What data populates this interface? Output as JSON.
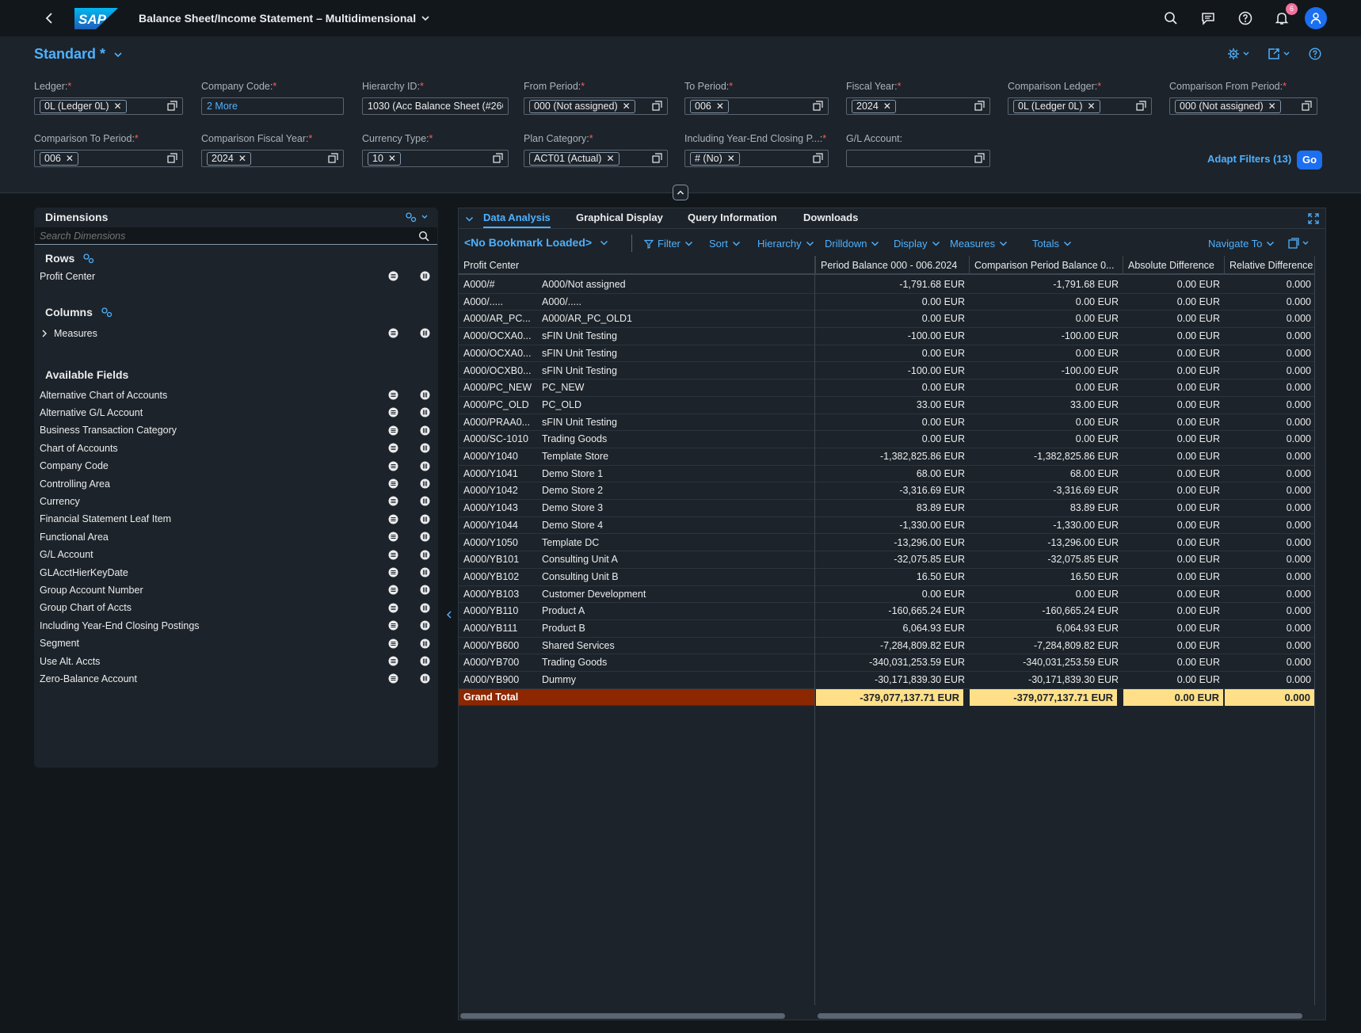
{
  "app": {
    "title": "Balance Sheet/Income Statement – Multidimensional",
    "logo_text": "SAP",
    "notification_count": "6"
  },
  "variant": {
    "name": "Standard *"
  },
  "filters": [
    {
      "label": "Ledger:",
      "type": "token",
      "value": "0L (Ledger 0L)"
    },
    {
      "label": "Company Code:",
      "type": "more",
      "value": "2 More"
    },
    {
      "label": "Hierarchy ID:",
      "type": "text",
      "value": "1030 (Acc Balance Sheet (#266"
    },
    {
      "label": "From Period:",
      "type": "token",
      "value": "000 (Not assigned)"
    },
    {
      "label": "To Period:",
      "type": "token",
      "value": "006"
    },
    {
      "label": "Fiscal Year:",
      "type": "token",
      "value": "2024"
    },
    {
      "label": "Comparison Ledger:",
      "type": "token",
      "value": "0L (Ledger 0L)"
    },
    {
      "label": "Comparison From Period:",
      "type": "token",
      "value": "000 (Not assigned)"
    },
    {
      "label": "Comparison To Period:",
      "type": "token",
      "value": "006"
    },
    {
      "label": "Comparison Fiscal Year:",
      "type": "token",
      "value": "2024"
    },
    {
      "label": "Currency Type:",
      "type": "token",
      "value": "10"
    },
    {
      "label": "Plan Category:",
      "type": "token",
      "value": "ACT01 (Actual)"
    },
    {
      "label": "Including Year-End Closing P...:",
      "type": "token",
      "value": "# (No)"
    },
    {
      "label": "G/L Account:",
      "type": "empty",
      "value": ""
    }
  ],
  "filterbar": {
    "adapt_label": "Adapt Filters (13)",
    "go_label": "Go"
  },
  "dimensions": {
    "title": "Dimensions",
    "search_placeholder": "Search Dimensions",
    "rows_title": "Rows",
    "rows": [
      "Profit Center"
    ],
    "columns_title": "Columns",
    "columns": [
      "Measures"
    ],
    "available_title": "Available Fields",
    "available": [
      "Alternative Chart of Accounts",
      "Alternative G/L Account",
      "Business Transaction Category",
      "Chart of Accounts",
      "Company Code",
      "Controlling Area",
      "Currency",
      "Financial Statement Leaf Item",
      "Functional Area",
      "G/L Account",
      "GLAcctHierKeyDate",
      "Group Account Number",
      "Group Chart of Accts",
      "Including Year-End Closing Postings",
      "Segment",
      "Use Alt. Accts",
      "Zero-Balance Account"
    ]
  },
  "tabs": [
    "Data Analysis",
    "Graphical Display",
    "Query Information",
    "Downloads"
  ],
  "toolbar": {
    "bookmark": "<No Bookmark Loaded>",
    "items": [
      "Filter",
      "Sort",
      "Hierarchy",
      "Drilldown",
      "Display",
      "Measures",
      "Totals"
    ],
    "navigate": "Navigate To"
  },
  "table": {
    "headers": [
      "Profit Center",
      "Period Balance 000 - 006.2024",
      "Comparison Period Balance 0...",
      "Absolute Difference",
      "Relative Difference"
    ],
    "rows": [
      [
        "A000/#",
        "A000/Not assigned",
        "-1,791.68 EUR",
        "-1,791.68 EUR",
        "0.00 EUR",
        "0.000"
      ],
      [
        "A000/.....",
        "A000/.....",
        "0.00 EUR",
        "0.00 EUR",
        "0.00 EUR",
        "0.000"
      ],
      [
        "A000/AR_PC...",
        "A000/AR_PC_OLD1",
        "0.00 EUR",
        "0.00 EUR",
        "0.00 EUR",
        "0.000"
      ],
      [
        "A000/OCXA0...",
        "sFIN Unit Testing",
        "-100.00 EUR",
        "-100.00 EUR",
        "0.00 EUR",
        "0.000"
      ],
      [
        "A000/OCXA0...",
        "sFIN Unit Testing",
        "0.00 EUR",
        "0.00 EUR",
        "0.00 EUR",
        "0.000"
      ],
      [
        "A000/OCXB0...",
        "sFIN Unit Testing",
        "-100.00 EUR",
        "-100.00 EUR",
        "0.00 EUR",
        "0.000"
      ],
      [
        "A000/PC_NEW",
        "PC_NEW",
        "0.00 EUR",
        "0.00 EUR",
        "0.00 EUR",
        "0.000"
      ],
      [
        "A000/PC_OLD",
        "PC_OLD",
        "33.00 EUR",
        "33.00 EUR",
        "0.00 EUR",
        "0.000"
      ],
      [
        "A000/PRAA0...",
        "sFIN Unit Testing",
        "0.00 EUR",
        "0.00 EUR",
        "0.00 EUR",
        "0.000"
      ],
      [
        "A000/SC-1010",
        "Trading Goods",
        "0.00 EUR",
        "0.00 EUR",
        "0.00 EUR",
        "0.000"
      ],
      [
        "A000/Y1040",
        "Template Store",
        "-1,382,825.86 EUR",
        "-1,382,825.86 EUR",
        "0.00 EUR",
        "0.000"
      ],
      [
        "A000/Y1041",
        "Demo Store 1",
        "68.00 EUR",
        "68.00 EUR",
        "0.00 EUR",
        "0.000"
      ],
      [
        "A000/Y1042",
        "Demo Store 2",
        "-3,316.69 EUR",
        "-3,316.69 EUR",
        "0.00 EUR",
        "0.000"
      ],
      [
        "A000/Y1043",
        "Demo Store 3",
        "83.89 EUR",
        "83.89 EUR",
        "0.00 EUR",
        "0.000"
      ],
      [
        "A000/Y1044",
        "Demo Store 4",
        "-1,330.00 EUR",
        "-1,330.00 EUR",
        "0.00 EUR",
        "0.000"
      ],
      [
        "A000/Y1050",
        "Template DC",
        "-13,296.00 EUR",
        "-13,296.00 EUR",
        "0.00 EUR",
        "0.000"
      ],
      [
        "A000/YB101",
        "Consulting Unit A",
        "-32,075.85 EUR",
        "-32,075.85 EUR",
        "0.00 EUR",
        "0.000"
      ],
      [
        "A000/YB102",
        "Consulting Unit B",
        "16.50 EUR",
        "16.50 EUR",
        "0.00 EUR",
        "0.000"
      ],
      [
        "A000/YB103",
        "Customer Development",
        "0.00 EUR",
        "0.00 EUR",
        "0.00 EUR",
        "0.000"
      ],
      [
        "A000/YB110",
        "Product A",
        "-160,665.24 EUR",
        "-160,665.24 EUR",
        "0.00 EUR",
        "0.000"
      ],
      [
        "A000/YB111",
        "Product B",
        "6,064.93 EUR",
        "6,064.93 EUR",
        "0.00 EUR",
        "0.000"
      ],
      [
        "A000/YB600",
        "Shared Services",
        "-7,284,809.82 EUR",
        "-7,284,809.82 EUR",
        "0.00 EUR",
        "0.000"
      ],
      [
        "A000/YB700",
        "Trading Goods",
        "-340,031,253.59 EUR",
        "-340,031,253.59 EUR",
        "0.00 EUR",
        "0.000"
      ],
      [
        "A000/YB900",
        "Dummy",
        "-30,171,839.30 EUR",
        "-30,171,839.30 EUR",
        "0.00 EUR",
        "0.000"
      ]
    ],
    "total": [
      "Grand Total",
      "-379,077,137.71 EUR",
      "-379,077,137.71 EUR",
      "0.00 EUR",
      "0.000"
    ]
  },
  "colors": {
    "accent": "#4db1ff",
    "total_row": "#8c2700",
    "total_cell": "#ffe088",
    "button": "#1b6ff0"
  }
}
